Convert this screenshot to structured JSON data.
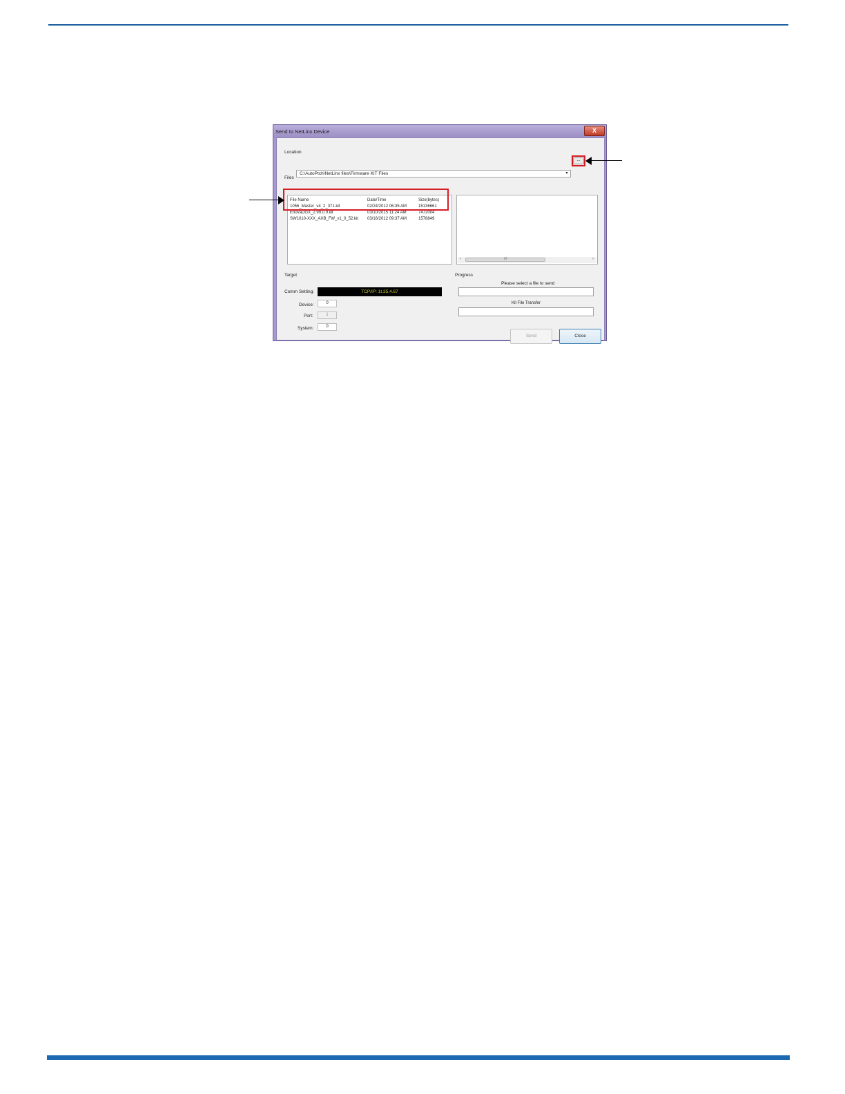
{
  "dialog": {
    "title": "Send to NetLinx Device",
    "close_label": "X",
    "location": {
      "label": "Location",
      "value": "C:\\AutoPtch\\NetLinx files\\Firmware KIT Files",
      "dropdown_arrow": "▾",
      "browse_label": "..."
    },
    "files": {
      "label": "Files",
      "columns": [
        "File Name",
        "Date/Time",
        "Size(bytes)"
      ],
      "rows": [
        [
          "1056_Master_v4_2_371.kit",
          "02/24/2012  06:35 AM",
          "15136661"
        ],
        [
          "EnovaDGX_2.99.0.9.kit",
          "03/10/2015  11:24 AM",
          "7472004"
        ],
        [
          "SW1010-XXX_AXB_FW_v1_0_52.kit",
          "03/16/2012  09:37 AM",
          "1578849"
        ]
      ]
    },
    "scrollbar": {
      "left_arrow": "‹",
      "right_arrow": "›",
      "grip": "III"
    },
    "target": {
      "label": "Target",
      "comm_label": "Comm Setting:",
      "comm_value": "TCP/IP: 1t.35.4.67",
      "device_label": "Device:",
      "device_value": "0",
      "port_label": "Port:",
      "port_value": "1",
      "system_label": "System:",
      "system_value": "0"
    },
    "progress": {
      "label": "Progress",
      "status_text": "Please select a file to send",
      "transfer_label": "Kit File Transfer",
      "progress_value": 0,
      "transfer_value": 0
    },
    "buttons": {
      "send": "Send",
      "close": "Close"
    }
  },
  "colors": {
    "highlight": "#d41c23",
    "rule": "#1d69b1",
    "dialog_frame": "#a79bcd",
    "comm_text": "#c9c93a"
  }
}
